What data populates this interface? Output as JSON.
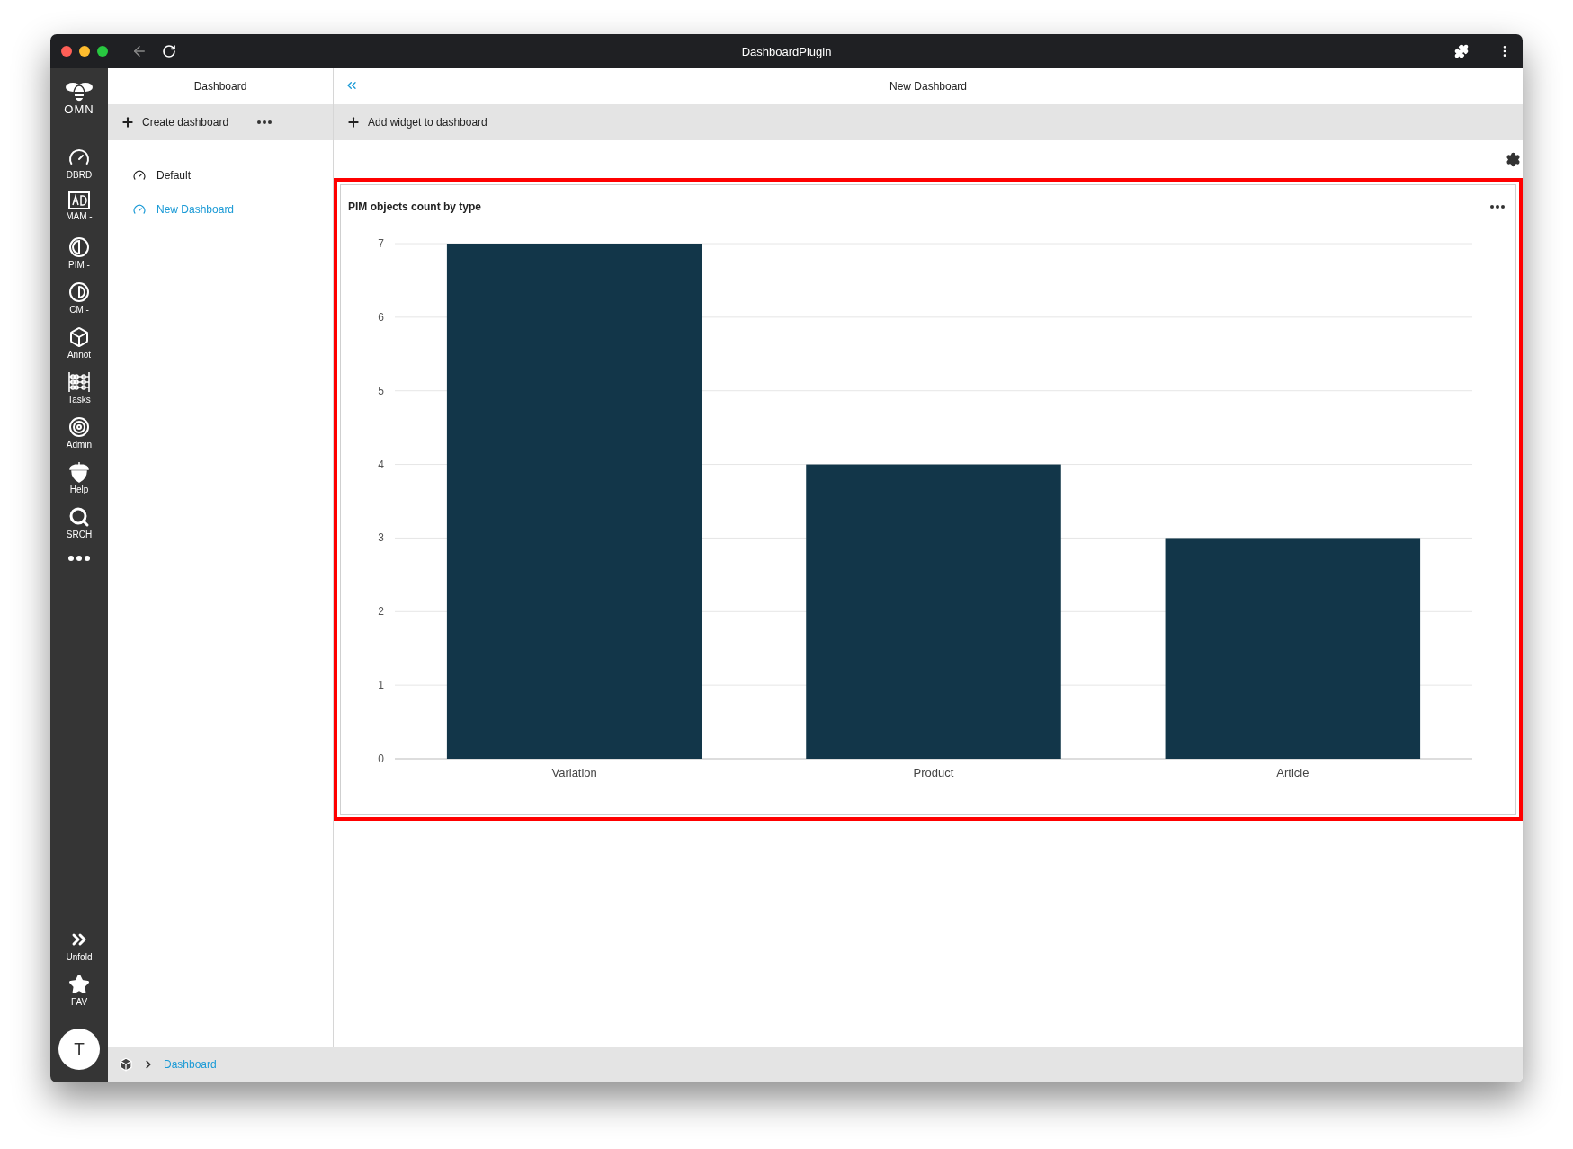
{
  "window": {
    "title": "DashboardPlugin"
  },
  "rail": {
    "logo": "OMN",
    "items": [
      {
        "label": "DBRD"
      },
      {
        "label": "MAM -"
      },
      {
        "label": "PIM -"
      },
      {
        "label": "CM -"
      },
      {
        "label": "Annot"
      },
      {
        "label": "Tasks"
      },
      {
        "label": "Admin"
      },
      {
        "label": "Help"
      },
      {
        "label": "SRCH"
      }
    ],
    "bottom": [
      {
        "label": "Unfold"
      },
      {
        "label": "FAV"
      }
    ],
    "avatar": "T"
  },
  "dashboards_panel": {
    "title": "Dashboard",
    "create_button": "Create dashboard",
    "items": [
      {
        "label": "Default",
        "selected": false
      },
      {
        "label": "New Dashboard",
        "selected": true
      }
    ]
  },
  "main": {
    "title": "New Dashboard",
    "add_button": "Add widget to dashboard"
  },
  "widget": {
    "title": "PIM objects count by type",
    "highlighted": true,
    "chart_data": {
      "type": "bar",
      "categories": [
        "Variation",
        "Product",
        "Article"
      ],
      "series": [
        {
          "color": "#123649",
          "values": [
            7,
            4,
            3
          ]
        }
      ],
      "ylim": [
        0,
        7
      ],
      "yticks": [
        0,
        1,
        2,
        3,
        4,
        5,
        6,
        7
      ],
      "grid": true
    }
  },
  "breadcrumb": [
    {
      "label": "Dashboard"
    }
  ]
}
